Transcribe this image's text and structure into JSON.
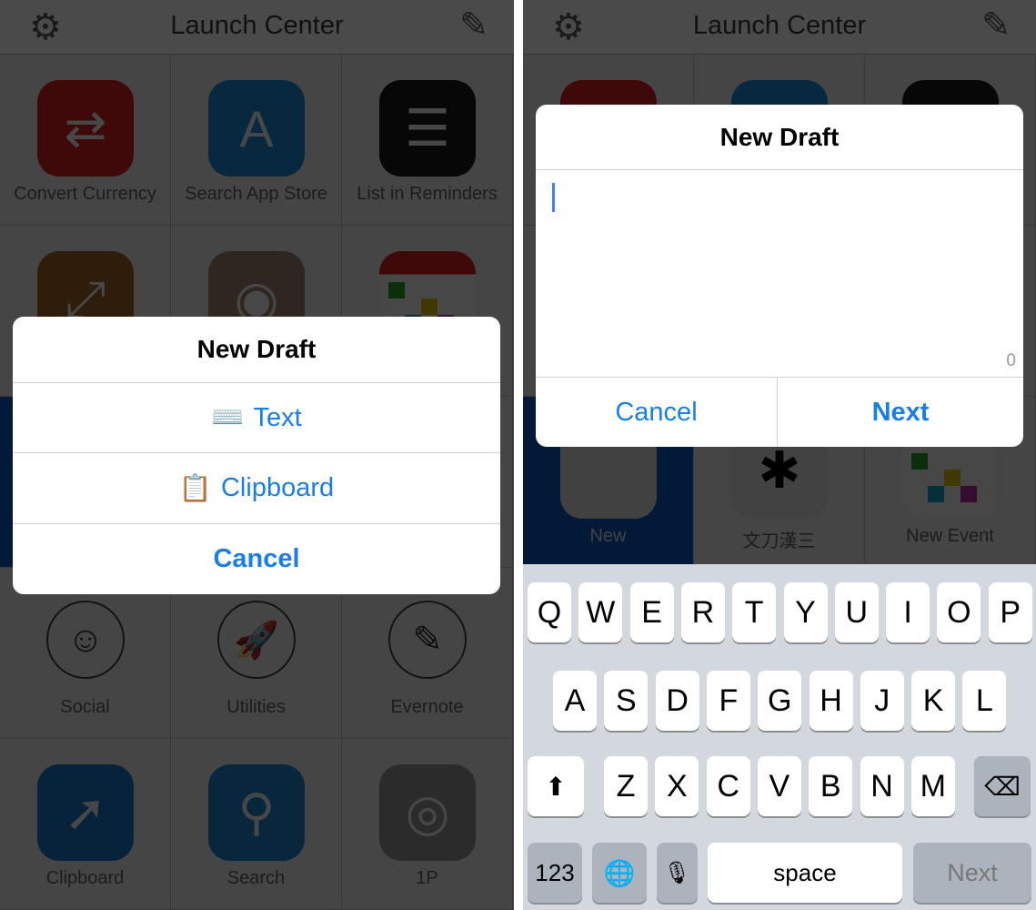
{
  "app_title": "Launch Center",
  "nav_icons": {
    "left": "gear-icon",
    "right": "pencil-icon"
  },
  "grid": [
    {
      "label": "Convert Currency",
      "icon": "currency-icon",
      "color": "#e52222",
      "glyph": "⇄"
    },
    {
      "label": "Search App Store",
      "icon": "app-store-icon",
      "color": "#1e8fe6",
      "glyph": "A"
    },
    {
      "label": "List in Reminders",
      "icon": "reminders-icon",
      "color": "#1a1a1a",
      "glyph": "☰"
    },
    {
      "label": "",
      "icon": "resize-icon",
      "color": "#a86a2a",
      "glyph": "⤢"
    },
    {
      "label": "",
      "icon": "instagram-icon",
      "color": "#a88a70",
      "glyph": "◉"
    },
    {
      "label": "",
      "icon": "calendar-icon",
      "color": "#ffffff",
      "glyph": ""
    },
    {
      "label": "New",
      "icon": "drafts-icon",
      "color": "#e8e8e8",
      "glyph": "",
      "cellbg": "#0a5fc8"
    },
    {
      "label": "文刀漢三",
      "icon": "asterisk-icon",
      "color": "#ececec",
      "glyph": "✱"
    },
    {
      "label": "New Event",
      "icon": "calendar-icon",
      "color": "#ffffff",
      "glyph": ""
    },
    {
      "label": "Social",
      "icon": "smiley-icon",
      "round": true,
      "glyph": "☺"
    },
    {
      "label": "Utilities",
      "icon": "rocket-icon",
      "round": true,
      "glyph": "🚀"
    },
    {
      "label": "Evernote",
      "icon": "pencil-icon",
      "round": true,
      "glyph": "✎"
    },
    {
      "label": "Clipboard",
      "icon": "safari-icon",
      "color": "#1c7fd8",
      "glyph": "➚"
    },
    {
      "label": "Search",
      "icon": "search-icon",
      "color": "#1e88d8",
      "glyph": "⚲"
    },
    {
      "label": "1P",
      "icon": "1password-icon",
      "color": "#9a9a9a",
      "glyph": "◎"
    }
  ],
  "action_sheet": {
    "title": "New Draft",
    "items": [
      {
        "label": "Text",
        "emoji": "⌨️"
      },
      {
        "label": "Clipboard",
        "emoji": "📋"
      }
    ],
    "cancel": "Cancel"
  },
  "dialog": {
    "title": "New Draft",
    "text": "",
    "char_count": "0",
    "cancel": "Cancel",
    "next": "Next"
  },
  "keyboard": {
    "row1": [
      "Q",
      "W",
      "E",
      "R",
      "T",
      "Y",
      "U",
      "I",
      "O",
      "P"
    ],
    "row2": [
      "A",
      "S",
      "D",
      "F",
      "G",
      "H",
      "J",
      "K",
      "L"
    ],
    "row3": [
      "Z",
      "X",
      "C",
      "V",
      "B",
      "N",
      "M"
    ],
    "numbers": "123",
    "space": "space",
    "return": "Next",
    "icons": {
      "shift": "shift-icon",
      "delete": "delete-icon",
      "globe": "globe-icon",
      "mic": "microphone-icon"
    }
  },
  "colors": {
    "accent": "#1a7ee6",
    "cursor": "#4a7de8"
  }
}
